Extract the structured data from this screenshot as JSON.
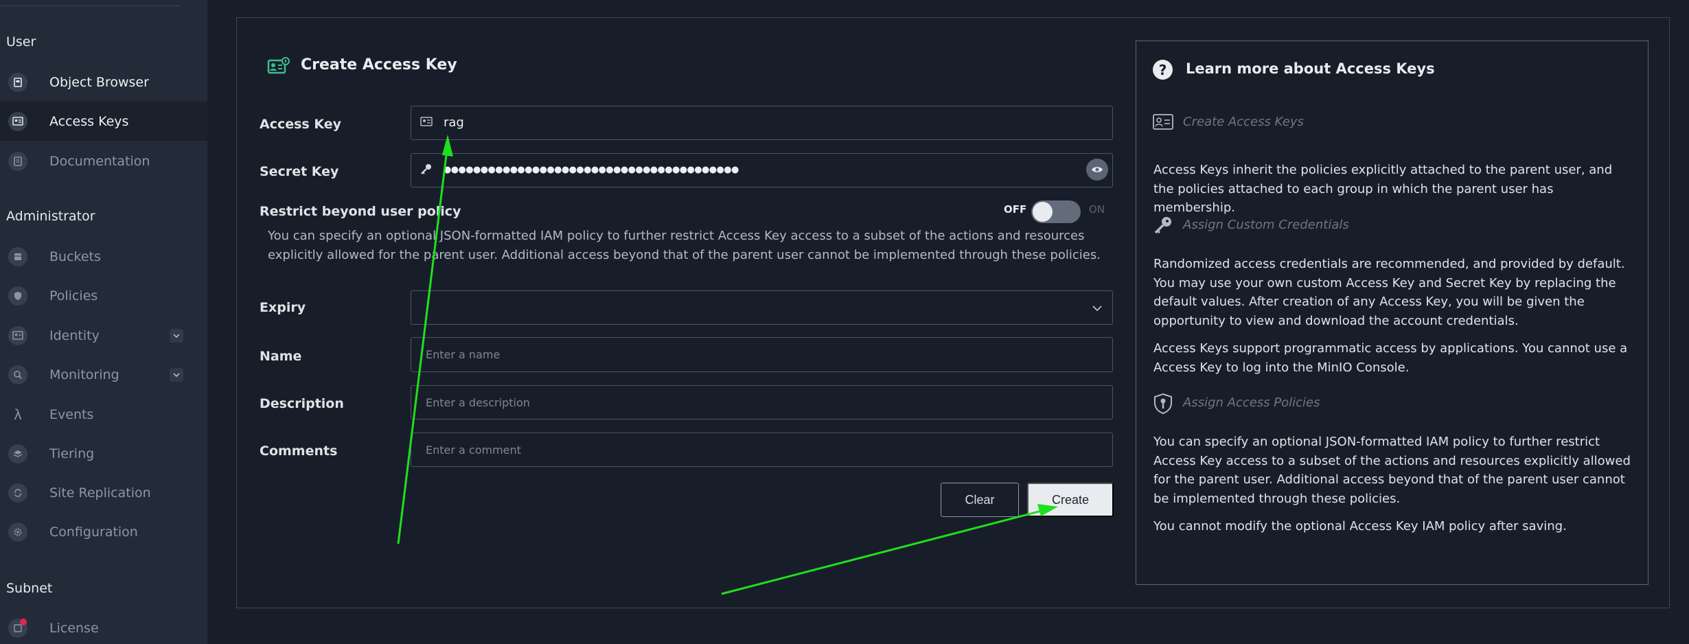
{
  "sidebar": {
    "sections": [
      {
        "title": "User"
      },
      {
        "title": "Administrator"
      },
      {
        "title": "Subnet"
      }
    ],
    "items": [
      {
        "label": "Object Browser"
      },
      {
        "label": "Access Keys"
      },
      {
        "label": "Documentation"
      },
      {
        "label": "Buckets"
      },
      {
        "label": "Policies"
      },
      {
        "label": "Identity"
      },
      {
        "label": "Monitoring"
      },
      {
        "label": "Events"
      },
      {
        "label": "Tiering"
      },
      {
        "label": "Site Replication"
      },
      {
        "label": "Configuration"
      },
      {
        "label": "License"
      }
    ]
  },
  "form": {
    "title": "Create Access Key",
    "access_key": {
      "label": "Access Key",
      "value": "rag"
    },
    "secret_key": {
      "label": "Secret Key",
      "value": "●●●●●●●●●●●●●●●●●●●●●●●●●●●●●●●●●●●●●●●●"
    },
    "restrict": {
      "label": "Restrict beyond user policy",
      "off_label": "OFF",
      "on_label": "ON",
      "enabled": false,
      "help": "You can specify an optional JSON-formatted IAM policy to further restrict Access Key access to a subset of the actions and resources explicitly allowed for the parent user. Additional access beyond that of the parent user cannot be implemented through these policies."
    },
    "expiry": {
      "label": "Expiry",
      "value": ""
    },
    "name": {
      "label": "Name",
      "placeholder": "Enter a name"
    },
    "description": {
      "label": "Description",
      "placeholder": "Enter a description"
    },
    "comments": {
      "label": "Comments",
      "placeholder": "Enter a comment"
    },
    "clear_label": "Clear",
    "create_label": "Create"
  },
  "help": {
    "title": "Learn more about Access Keys",
    "sections": [
      {
        "subtitle": "Create Access Keys",
        "paragraphs": [
          "Access Keys inherit the policies explicitly attached to the parent user, and the policies attached to each group in which the parent user has membership."
        ]
      },
      {
        "subtitle": "Assign Custom Credentials",
        "paragraphs": [
          "Randomized access credentials are recommended, and provided by default. You may use your own custom Access Key and Secret Key by replacing the default values. After creation of any Access Key, you will be given the opportunity to view and download the account credentials.",
          "Access Keys support programmatic access by applications. You cannot use a Access Key to log into the MinIO Console."
        ]
      },
      {
        "subtitle": "Assign Access Policies",
        "paragraphs": [
          "You can specify an optional JSON-formatted IAM policy to further restrict Access Key access to a subset of the actions and resources explicitly allowed for the parent user. Additional access beyond that of the parent user cannot be implemented through these policies.",
          "You cannot modify the optional Access Key IAM policy after saving."
        ]
      }
    ]
  },
  "colors": {
    "background": "#181e29",
    "sidebar": "#232b38",
    "annotation_arrow": "#1ee01e",
    "license_badge": "#e3264e"
  },
  "annotations": {
    "arrows": [
      {
        "target": "access-key-input"
      },
      {
        "target": "create-button"
      }
    ]
  }
}
